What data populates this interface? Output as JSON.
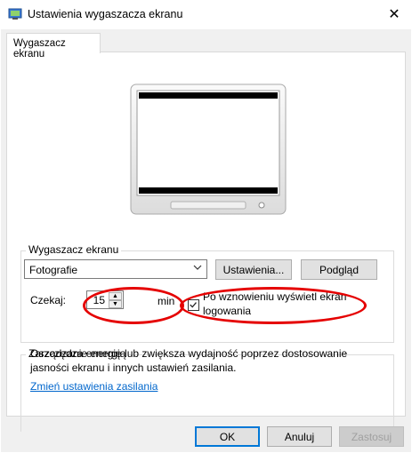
{
  "window": {
    "title": "Ustawienia wygaszacza ekranu"
  },
  "tab": {
    "label": "Wygaszacz ekranu"
  },
  "screensaver": {
    "group_label": "Wygaszacz ekranu",
    "selected": "Fotografie",
    "settings_button": "Ustawienia...",
    "preview_button": "Podgląd",
    "wait_label": "Czekaj:",
    "wait_value": "15",
    "wait_unit": "min",
    "resume_checkbox_checked": true,
    "resume_label_line1": "Po wznowieniu wyświetl ekran",
    "resume_label_line2": "logowania"
  },
  "power": {
    "group_label": "Zarządzanie energią",
    "description_line1": "Oszczędza energię lub zwiększa wydajność poprzez dostosowanie",
    "description_line2": "jasności ekranu i innych ustawień zasilania.",
    "link": "Zmień ustawienia zasilania"
  },
  "buttons": {
    "ok": "OK",
    "cancel": "Anuluj",
    "apply": "Zastosuj"
  },
  "colors": {
    "annotation": "#e50000",
    "accent": "#0078d7",
    "link": "#0066cc"
  },
  "icons": {
    "app": "display-settings-icon",
    "close": "close-icon",
    "dropdown": "chevron-down-icon"
  }
}
